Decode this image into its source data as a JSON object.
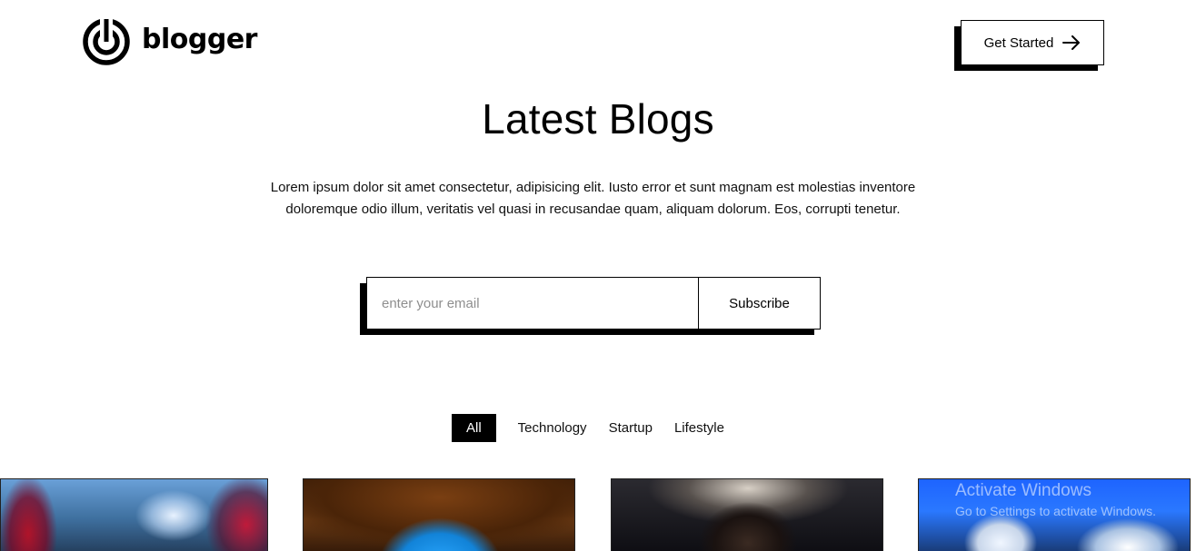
{
  "header": {
    "logo_text": "blogger",
    "logo_icon": "target-logo-icon",
    "cta_label": "Get Started",
    "cta_icon": "arrow-right-icon"
  },
  "hero": {
    "title": "Latest Blogs",
    "description": "Lorem ipsum dolor sit amet consectetur, adipisicing elit. Iusto error et sunt magnam est molestias inventore doloremque odio illum, veritatis vel quasi in recusandae quam, aliquam dolorum. Eos, corrupti tenetur."
  },
  "subscribe": {
    "placeholder": "enter your email",
    "value": "",
    "button_label": "Subscribe"
  },
  "filters": {
    "tabs": [
      {
        "label": "All",
        "active": true
      },
      {
        "label": "Technology",
        "active": false
      },
      {
        "label": "Startup",
        "active": false
      },
      {
        "label": "Lifestyle",
        "active": false
      }
    ]
  },
  "cards": [
    {
      "image": "superhero-city-image"
    },
    {
      "image": "cave-arch-image"
    },
    {
      "image": "portrait-image"
    },
    {
      "image": "snowy-mountain-image"
    }
  ],
  "watermark": {
    "title": "Activate Windows",
    "subtitle": "Go to Settings to activate Windows."
  },
  "colors": {
    "primary": "#000000",
    "background": "#ffffff",
    "placeholder": "#8e8e8e"
  }
}
